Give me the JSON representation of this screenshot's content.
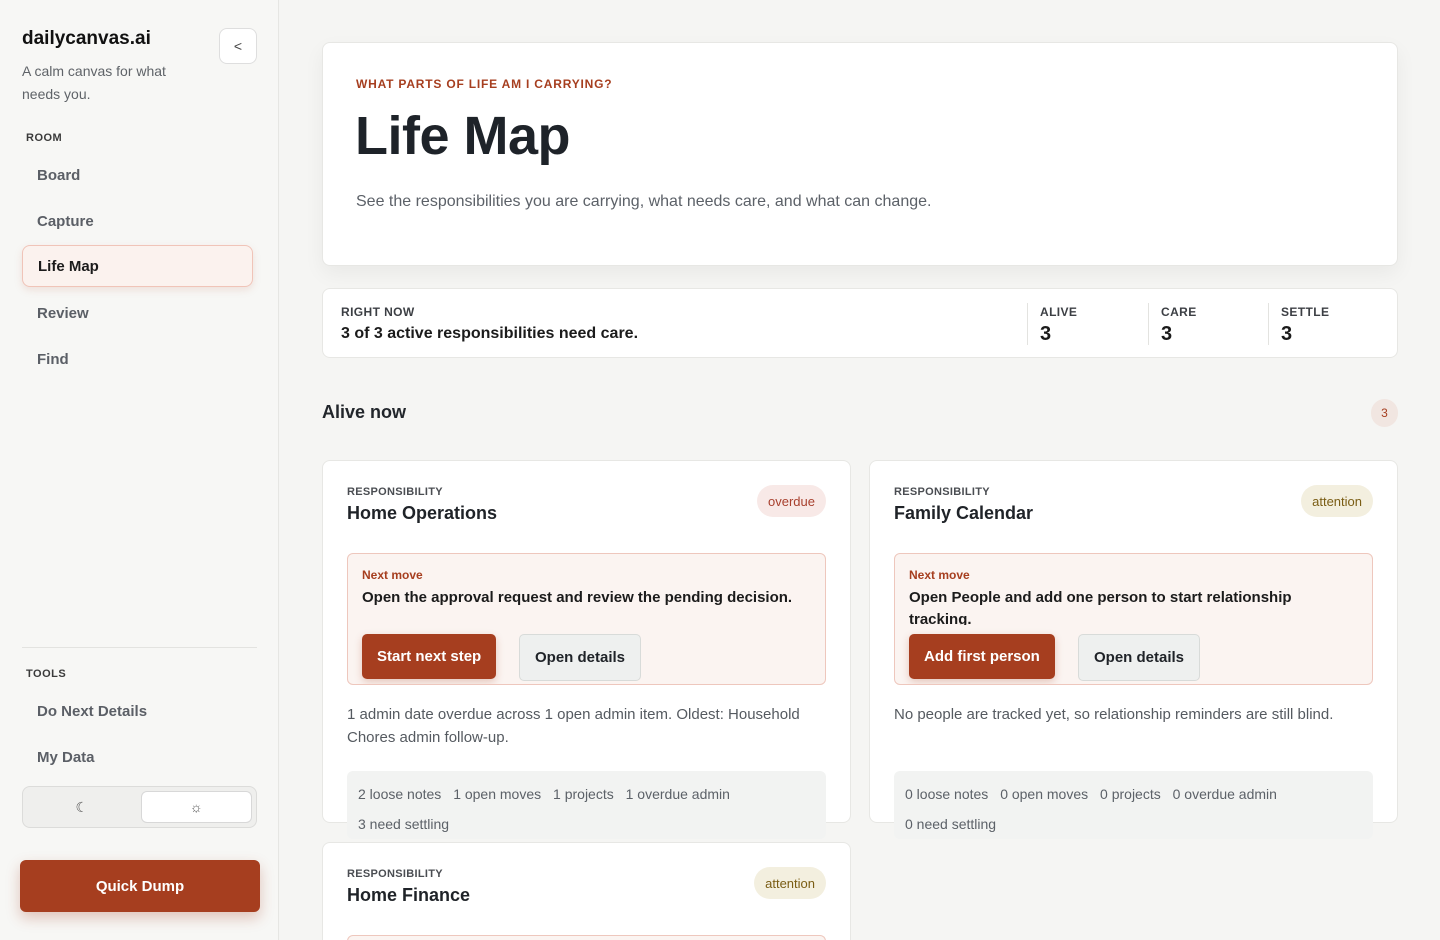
{
  "sidebar": {
    "brand": "dailycanvas.ai",
    "tagline": "A calm canvas for what needs you.",
    "collapse_label": "<",
    "room_label": "ROOM",
    "nav": [
      "Board",
      "Capture",
      "Life Map",
      "Review",
      "Find"
    ],
    "active_nav": "Life Map",
    "tools_label": "TOOLS",
    "tools": [
      "Do Next Details",
      "My Data"
    ],
    "theme": {
      "dark_icon": "☾",
      "light_icon": "☼"
    },
    "quick_dump": "Quick Dump"
  },
  "hero": {
    "eyebrow": "WHAT PARTS OF LIFE AM I CARRYING?",
    "title": "Life Map",
    "subtitle": "See the responsibilities you are carrying, what needs care, and what can change."
  },
  "status": {
    "label": "RIGHT NOW",
    "text": "3 of 3 active responsibilities need care.",
    "stats": [
      {
        "label": "ALIVE",
        "value": "3"
      },
      {
        "label": "CARE",
        "value": "3"
      },
      {
        "label": "SETTLE",
        "value": "3"
      }
    ]
  },
  "section": {
    "title": "Alive now",
    "count": "3"
  },
  "cards": [
    {
      "kicker": "RESPONSIBILITY",
      "title": "Home Operations",
      "badge": "overdue",
      "next_label": "Next move",
      "next_text": "Open the approval request and review the pending decision.",
      "primary": "Start next step",
      "secondary": "Open details",
      "desc": "1 admin date overdue across 1 open admin item. Oldest: Household Chores admin follow-up.",
      "tally": [
        "2 loose notes",
        "1 open moves",
        "1 projects",
        "1 overdue admin",
        "3 need settling"
      ]
    },
    {
      "kicker": "RESPONSIBILITY",
      "title": "Family Calendar",
      "badge": "attention",
      "next_label": "Next move",
      "next_text": "Open People and add one person to start relationship tracking.",
      "primary": "Add first person",
      "secondary": "Open details",
      "desc": "No people are tracked yet, so relationship reminders are still blind.",
      "tally": [
        "0 loose notes",
        "0 open moves",
        "0 projects",
        "0 overdue admin",
        "0 need settling"
      ]
    },
    {
      "kicker": "RESPONSIBILITY",
      "title": "Home Finance",
      "badge": "attention"
    }
  ],
  "colors": {
    "accent": "#a63e1f",
    "background": "#f5f5f3"
  }
}
